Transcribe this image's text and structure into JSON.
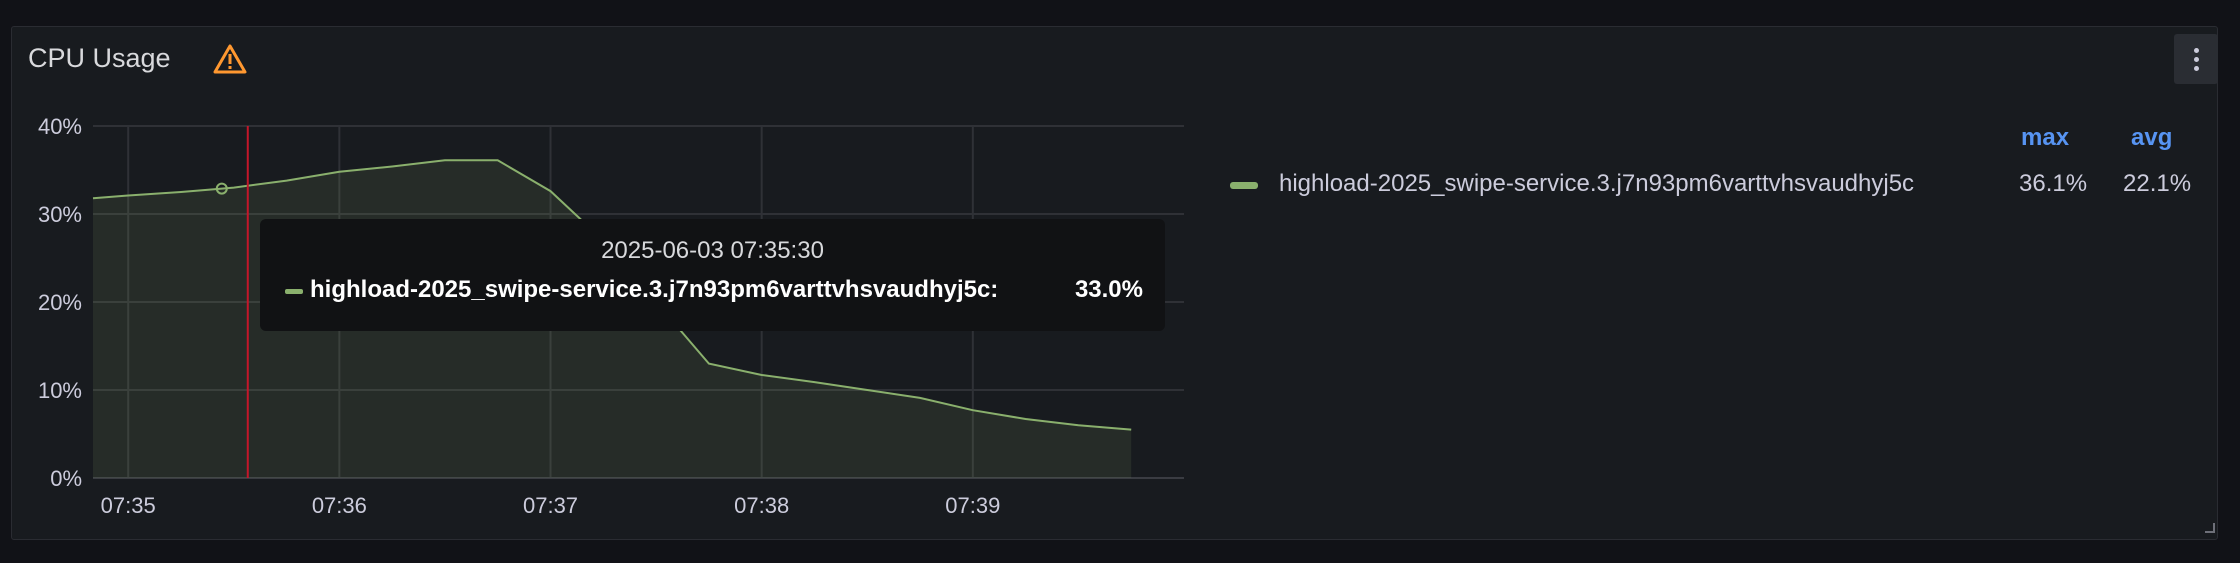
{
  "panel": {
    "title": "CPU Usage",
    "warning_icon": "warning-icon",
    "menu_icon": "vertical-dots-icon"
  },
  "chart_data": {
    "type": "area",
    "x": [
      "07:34:50",
      "07:35:00",
      "07:35:15",
      "07:35:30",
      "07:35:45",
      "07:36:00",
      "07:36:15",
      "07:36:30",
      "07:36:45",
      "07:37:00",
      "07:37:15",
      "07:37:30",
      "07:37:45",
      "07:38:00",
      "07:38:15",
      "07:38:30",
      "07:38:45",
      "07:39:00",
      "07:39:15",
      "07:39:30",
      "07:39:45"
    ],
    "series": [
      {
        "name": "highload-2025_swipe-service.3.j7n93pm6varttvhsvaudhyj5c",
        "color": "#8ab06d",
        "values": [
          31.8,
          32.1,
          32.5,
          33.0,
          33.8,
          34.8,
          35.4,
          36.1,
          36.1,
          32.6,
          27.0,
          20.0,
          13.0,
          11.7,
          10.9,
          10.0,
          9.1,
          7.7,
          6.7,
          6.0,
          5.5
        ]
      }
    ],
    "xticks": [
      "07:35",
      "07:36",
      "07:37",
      "07:38",
      "07:39"
    ],
    "yticks": [
      "0%",
      "10%",
      "20%",
      "30%",
      "40%"
    ],
    "ylim": [
      0,
      40
    ],
    "grid": true,
    "cursor_x": "07:35:30",
    "legend": {
      "placement": "right",
      "columns": [
        "max",
        "avg"
      ],
      "rows": [
        {
          "name": "highload-2025_swipe-service.3.j7n93pm6varttvhsvaudhyj5c",
          "max": "36.1%",
          "avg": "22.1%",
          "color": "#8ab06d"
        }
      ]
    }
  },
  "tooltip": {
    "time": "2025-06-03 07:35:30",
    "series_name": "highload-2025_swipe-service.3.j7n93pm6varttvhsvaudhyj5c:",
    "value": "33.0%"
  }
}
